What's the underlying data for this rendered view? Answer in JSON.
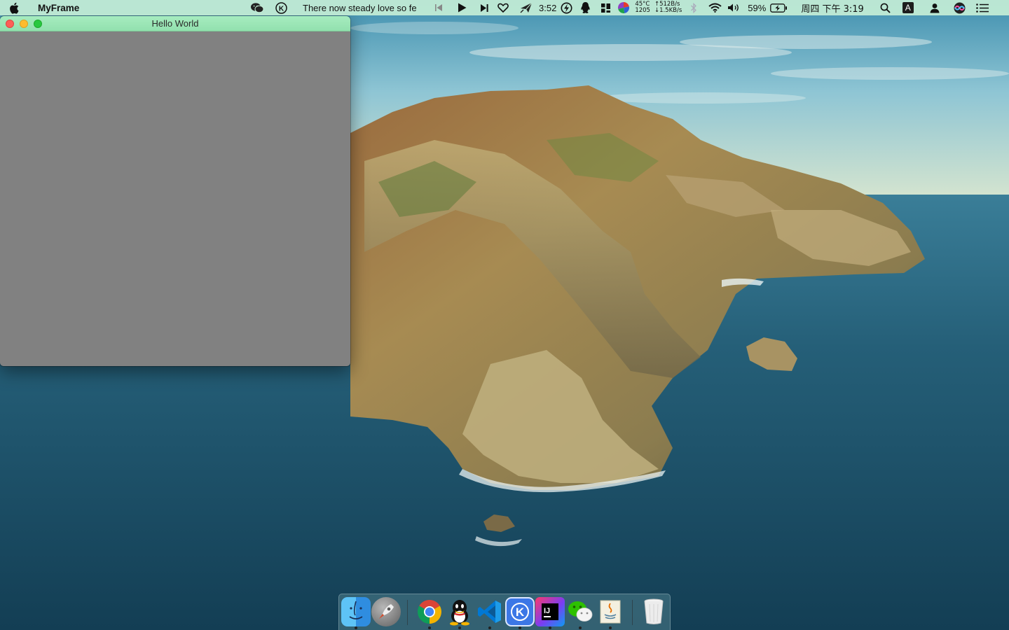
{
  "menubar": {
    "app_name": "MyFrame",
    "now_playing": "There now steady love so fe",
    "timer": "3:52",
    "temperature": "45°C",
    "fan_rpm": "1205",
    "net_up": "↑512B/s",
    "net_down": "↓1.5KB/s",
    "battery": "59%",
    "datetime": "周四 下午 3:19",
    "input_method": "A",
    "icons": [
      "apple-icon",
      "wechat-icon",
      "k-icon",
      "previous-track-icon",
      "play-icon",
      "next-track-icon",
      "heart-icon",
      "send-icon",
      "lightning-icon",
      "qq-icon",
      "grid-icon",
      "color-wheel-icon",
      "bluetooth-icon",
      "wifi-icon",
      "volume-icon",
      "battery-icon",
      "search-icon",
      "user-icon",
      "siri-icon",
      "control-center-icon"
    ]
  },
  "window": {
    "title": "Hello World",
    "content_color": "#818181",
    "titlebar_color": "#9fe8b8"
  },
  "dock": {
    "apps": [
      "Finder",
      "Launchpad",
      "Google Chrome",
      "QQ",
      "Visual Studio Code",
      "Keka",
      "IntelliJ IDEA",
      "WeChat",
      "Java",
      "Trash"
    ]
  },
  "colors": {
    "menubar": "#c4eed6",
    "ocean": "#1d4f63",
    "sky": "#8fc3d4",
    "land": "#a98a54"
  }
}
